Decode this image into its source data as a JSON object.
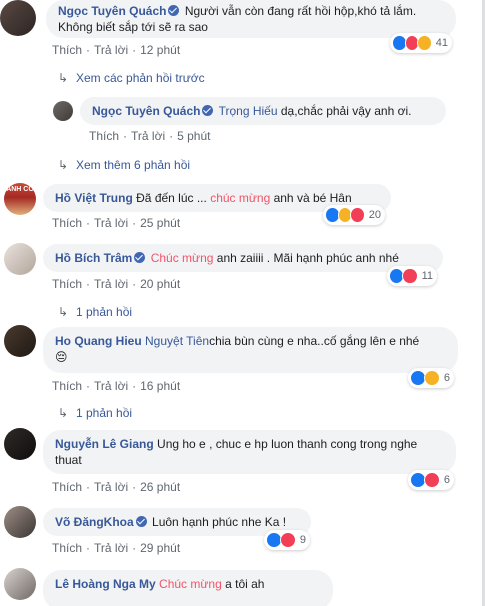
{
  "comments": [
    {
      "author": "Ngọc Tuyên Quách",
      "text": "Người vẫn còn đang rất hồi hộp,khó tả lắm. Không biết sắp tới sẽ ra sao",
      "like": "Thích",
      "reply": "Trả lời",
      "time": "12 phút",
      "reaction_count": "41"
    },
    {
      "author": "Ngọc Tuyên Quách",
      "mention": "Trọng Hiếu",
      "text": " dạ,chắc phải vậy anh ơi.",
      "like": "Thích",
      "reply": "Trả lời",
      "time": "5 phút"
    },
    {
      "author": "Hồ Việt Trung",
      "text_before": "Đã đến lúc ... ",
      "highlight": "chúc mừng",
      "text_after": " anh và bé Hân",
      "like": "Thích",
      "reply": "Trả lời",
      "time": "25 phút",
      "reaction_count": "20",
      "avatar_text": "ANH CÓ"
    },
    {
      "author": "Hồ Bích Trâm",
      "highlight": "Chúc mừng",
      "text_after": " anh zaiiii . Mãi hạnh phúc anh nhé",
      "like": "Thích",
      "reply": "Trả lời",
      "time": "20 phút",
      "reaction_count": "11"
    },
    {
      "author": "Ho Quang Hieu",
      "mention": "Nguyệt Tiên",
      "text": "chia bùn cùng e nha..cố gắng lên e nhé",
      "emoji": "😔",
      "like": "Thích",
      "reply": "Trả lời",
      "time": "16 phút",
      "reaction_count": "6"
    },
    {
      "author": "Nguyễn Lê Giang",
      "text": "Ung ho e , chuc e hp luon thanh cong trong nghe thuat",
      "like": "Thích",
      "reply": "Trả lời",
      "time": "26 phút",
      "reaction_count": "6"
    },
    {
      "author": "Võ ĐăngKhoa",
      "text": "Luôn hạnh phúc nhe Ka !",
      "like": "Thích",
      "reply": "Trả lời",
      "time": "29 phút",
      "reaction_count": "9"
    },
    {
      "author": "Lê Hoàng Nga My",
      "highlight": "Chúc mừng",
      "text_after": " a tôi ah"
    }
  ],
  "links": {
    "previous_replies": "Xem các phản hồi trước",
    "more_replies": "Xem thêm 6 phản hồi",
    "one_reply_a": "1 phản hồi",
    "one_reply_b": "1 phản hồi"
  },
  "separator": "·",
  "colors": {
    "name": "#385898",
    "highlight": "#f35369",
    "bubble": "#f2f3f5",
    "meta": "#606770"
  }
}
